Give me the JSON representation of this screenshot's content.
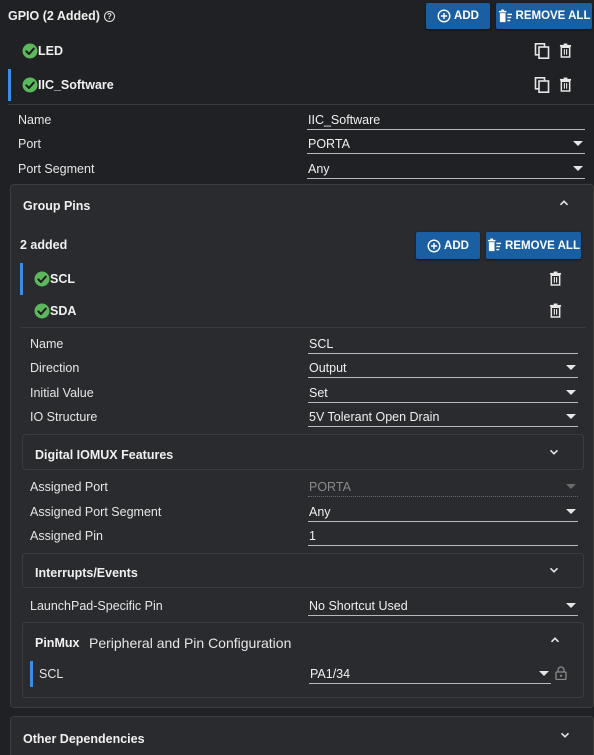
{
  "gpio": {
    "title": "GPIO (2 Added)",
    "add_label": "ADD",
    "remove_all_label": "REMOVE ALL",
    "items": [
      {
        "label": "LED",
        "selected": false
      },
      {
        "label": "IIC_Software",
        "selected": true
      }
    ]
  },
  "gpio_props": {
    "name_label": "Name",
    "name_value": "IIC_Software",
    "port_label": "Port",
    "port_value": "PORTA",
    "segment_label": "Port Segment",
    "segment_value": "Any"
  },
  "group_pins": {
    "title": "Group Pins",
    "count": "2 added",
    "add_label": "ADD",
    "remove_all_label": "REMOVE ALL",
    "items": [
      {
        "label": "SCL",
        "selected": true
      },
      {
        "label": "SDA",
        "selected": false
      }
    ]
  },
  "pin_props": {
    "name_label": "Name",
    "name_value": "SCL",
    "direction_label": "Direction",
    "direction_value": "Output",
    "initial_label": "Initial Value",
    "initial_value": "Set",
    "io_label": "IO Structure",
    "io_value": "5V Tolerant Open Drain"
  },
  "iomux": {
    "title": "Digital IOMUX Features",
    "assigned_port_label": "Assigned Port",
    "assigned_port_value": "PORTA",
    "assigned_segment_label": "Assigned Port Segment",
    "assigned_segment_value": "Any",
    "assigned_pin_label": "Assigned Pin",
    "assigned_pin_value": "1"
  },
  "interrupts": {
    "title": "Interrupts/Events"
  },
  "launchpad": {
    "label": "LaunchPad-Specific Pin",
    "value": "No Shortcut Used"
  },
  "pinmux": {
    "title": "PinMux",
    "subtitle": "Peripheral and Pin Configuration",
    "row_label": "SCL",
    "row_value": "PA1/34"
  },
  "other": {
    "title": "Other Dependencies"
  },
  "colors": {
    "accent": "#1b5fa3",
    "check": "#5cb85c",
    "selection": "#3a8ee6",
    "background": "#202124"
  },
  "icons": [
    "help-icon",
    "plus-circle-icon",
    "remove-all-icon",
    "check-circle-icon",
    "copy-icon",
    "trash-icon",
    "chevron-up-icon",
    "chevron-down-icon",
    "lock-icon"
  ]
}
